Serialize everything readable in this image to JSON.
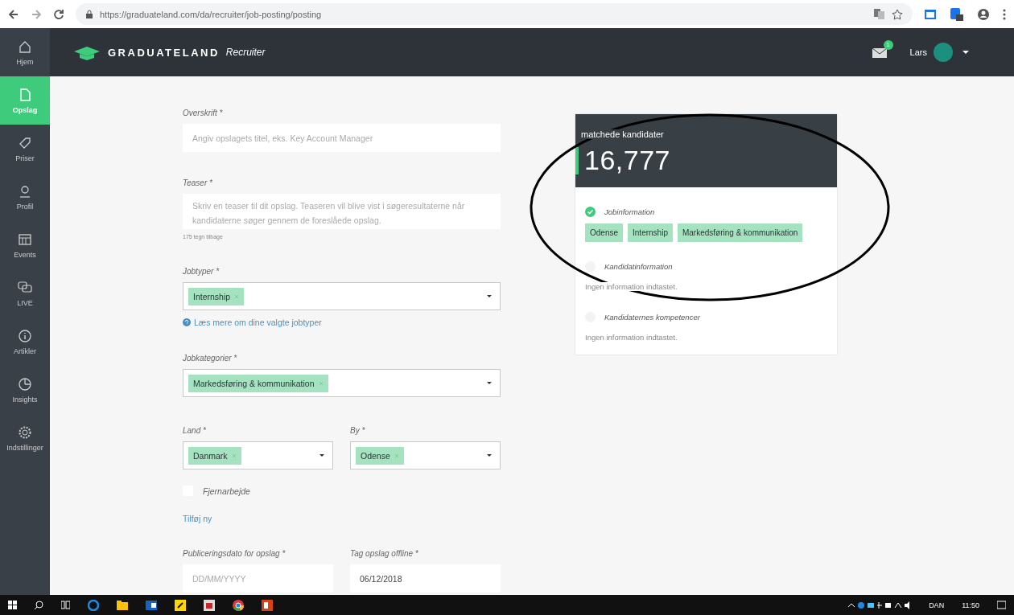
{
  "browser": {
    "url": "https://graduateland.com/da/recruiter/job-posting/posting"
  },
  "header": {
    "logo": "GRADUATELAND",
    "logo_suffix": "Recruiter",
    "message_count": "1",
    "user": "Lars"
  },
  "sidebar": {
    "items": [
      {
        "label": "Hjem",
        "selected": false
      },
      {
        "label": "Opslag",
        "selected": true
      },
      {
        "label": "Priser",
        "selected": false
      },
      {
        "label": "Profil",
        "selected": false
      },
      {
        "label": "Events",
        "selected": false
      },
      {
        "label": "LIVE",
        "selected": false
      },
      {
        "label": "Artikler",
        "selected": false
      },
      {
        "label": "Insights",
        "selected": false
      },
      {
        "label": "Indstillinger",
        "selected": false
      }
    ]
  },
  "form": {
    "headline": {
      "label": "Overskrift *",
      "placeholder": "Angiv opslagets titel, eks. Key Account Manager"
    },
    "teaser": {
      "label": "Teaser *",
      "placeholder": "Skriv en teaser til dit opslag. Teaseren vil blive vist i søgeresultaterne når kandidaterne søger gennem de foreslåede opslag.",
      "counter": "175 tegn tilbage"
    },
    "job_types": {
      "label": "Jobtyper *",
      "tags": [
        "Internship"
      ],
      "help_link": "Læs mere om dine valgte jobtyper"
    },
    "job_categories": {
      "label": "Jobkategorier *",
      "tags": [
        "Markedsføring & kommunikation"
      ]
    },
    "country": {
      "label": "Land *",
      "tags": [
        "Danmark"
      ]
    },
    "city": {
      "label": "By *",
      "tags": [
        "Odense"
      ]
    },
    "remote": {
      "label": "Fjernarbejde",
      "checked": false
    },
    "add_link": "Tilføj ny",
    "publish_date": {
      "label": "Publiceringsdato for opslag *",
      "placeholder": "DD/MM/YYYY"
    },
    "offline_date": {
      "label": "Tag opslag offline *",
      "value": "06/12/2018"
    }
  },
  "match_card": {
    "title": "matchede kandidater",
    "count": "16,777",
    "sections": [
      {
        "title": "Jobinformation",
        "complete": true,
        "tags": [
          "Odense",
          "Internship",
          "Markedsføring & kommunikation"
        ]
      },
      {
        "title": "Kandidatinformation",
        "complete": false,
        "empty_text": "Ingen information indtastet."
      },
      {
        "title": "Kandidaternes kompetencer",
        "complete": false,
        "empty_text": "Ingen information indtastet."
      }
    ]
  },
  "taskbar": {
    "language": "DAN",
    "time": "11:50"
  }
}
